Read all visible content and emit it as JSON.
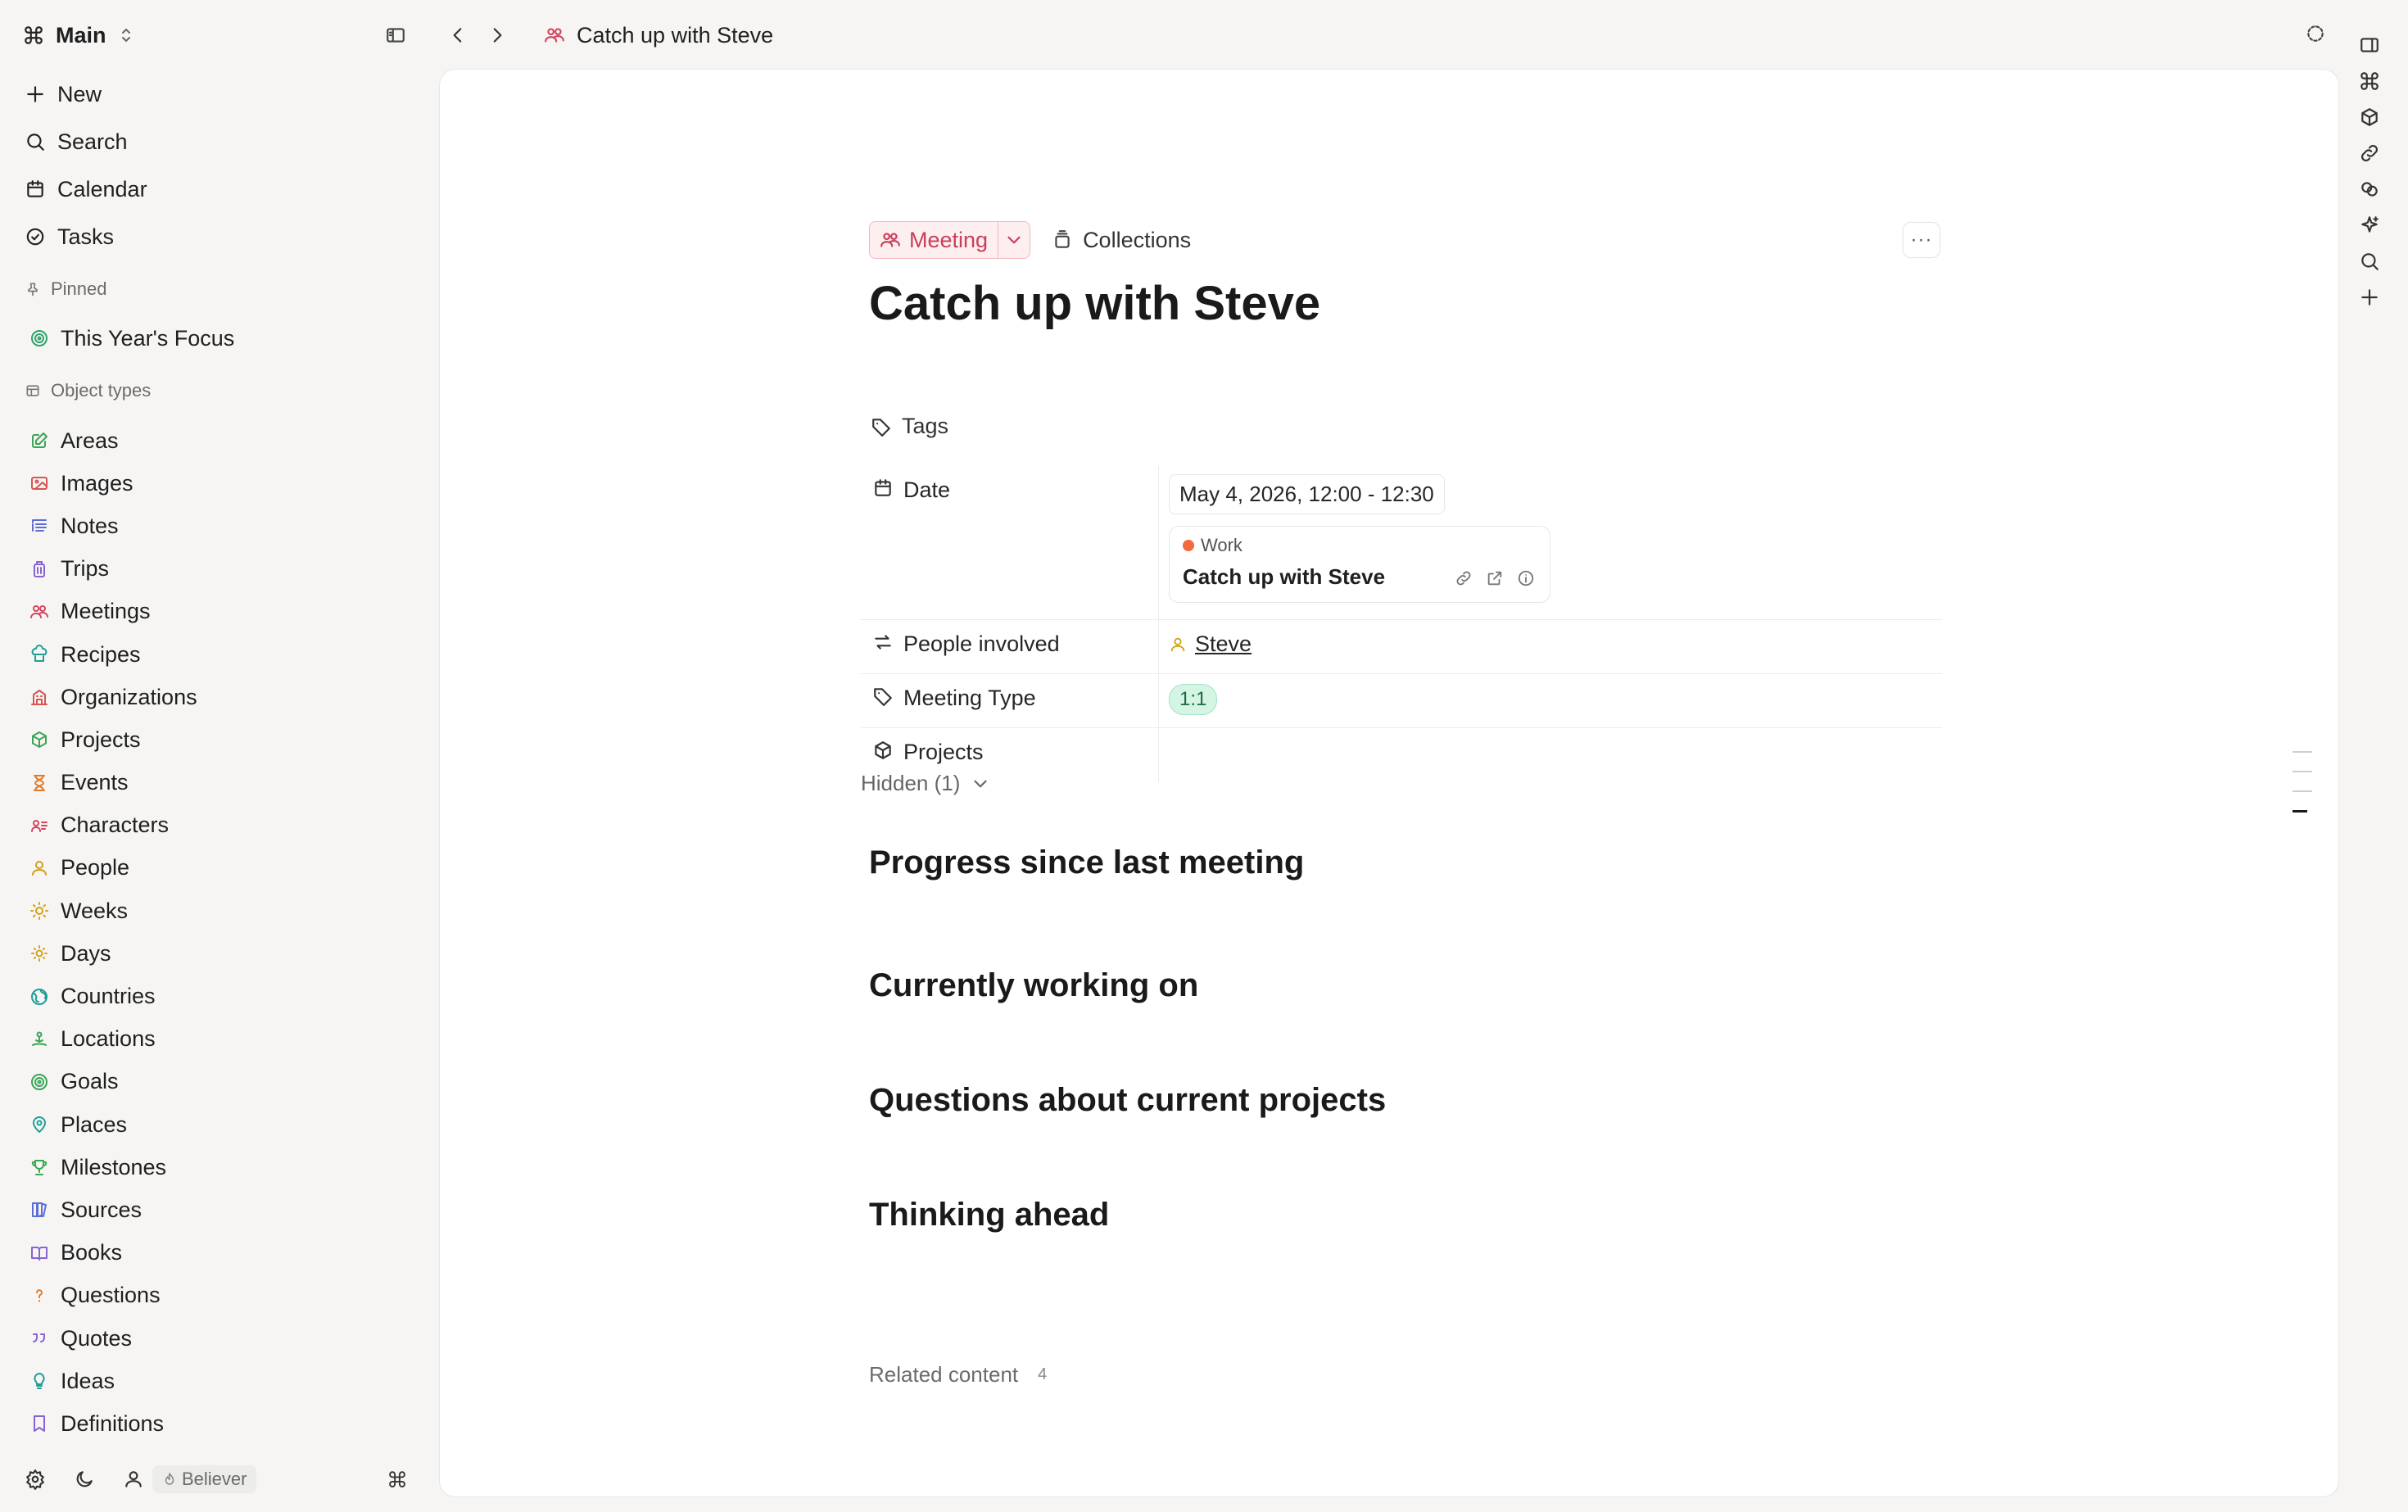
{
  "workspace": {
    "name": "Main"
  },
  "breadcrumb": {
    "title": "Catch up with Steve"
  },
  "nav": [
    {
      "label": "New",
      "icon": "plus-icon"
    },
    {
      "label": "Search",
      "icon": "search-icon"
    },
    {
      "label": "Calendar",
      "icon": "calendar-icon"
    },
    {
      "label": "Tasks",
      "icon": "check-circle-icon"
    }
  ],
  "pinned": {
    "label": "Pinned",
    "items": [
      {
        "label": "This Year's Focus",
        "icon": "target-icon",
        "color": "#2fa36b"
      }
    ]
  },
  "object_types": {
    "label": "Object types",
    "items": [
      {
        "label": "Areas",
        "icon": "pencil-square-icon",
        "color": "#3aa655"
      },
      {
        "label": "Images",
        "icon": "image-icon",
        "color": "#d9534f"
      },
      {
        "label": "Notes",
        "icon": "notes-icon",
        "color": "#5b6fd6"
      },
      {
        "label": "Trips",
        "icon": "luggage-icon",
        "color": "#8a63d2"
      },
      {
        "label": "Meetings",
        "icon": "people-icon",
        "color": "#d6455f"
      },
      {
        "label": "Recipes",
        "icon": "chef-hat-icon",
        "color": "#1f9e97"
      },
      {
        "label": "Organizations",
        "icon": "building-icon",
        "color": "#d9534f"
      },
      {
        "label": "Projects",
        "icon": "cube-icon",
        "color": "#3aa655"
      },
      {
        "label": "Events",
        "icon": "hourglass-icon",
        "color": "#e07b2b"
      },
      {
        "label": "Characters",
        "icon": "person-card-icon",
        "color": "#d6455f"
      },
      {
        "label": "People",
        "icon": "person-icon",
        "color": "#d4a017"
      },
      {
        "label": "Weeks",
        "icon": "sun-icon",
        "color": "#d4a017"
      },
      {
        "label": "Days",
        "icon": "sun-small-icon",
        "color": "#d4a017"
      },
      {
        "label": "Countries",
        "icon": "globe-icon",
        "color": "#1f9e97"
      },
      {
        "label": "Locations",
        "icon": "location-person-icon",
        "color": "#3aa655"
      },
      {
        "label": "Goals",
        "icon": "target-icon",
        "color": "#3aa655"
      },
      {
        "label": "Places",
        "icon": "map-pin-icon",
        "color": "#1f9e97"
      },
      {
        "label": "Milestones",
        "icon": "trophy-icon",
        "color": "#3aa655"
      },
      {
        "label": "Sources",
        "icon": "books-icon",
        "color": "#5b6fd6"
      },
      {
        "label": "Books",
        "icon": "open-book-icon",
        "color": "#8a63d2"
      },
      {
        "label": "Questions",
        "icon": "question-icon",
        "color": "#e07b2b"
      },
      {
        "label": "Quotes",
        "icon": "quote-icon",
        "color": "#8a63d2"
      },
      {
        "label": "Ideas",
        "icon": "lightbulb-icon",
        "color": "#1f9e97"
      },
      {
        "label": "Definitions",
        "icon": "bookmark-icon",
        "color": "#8a63d2"
      }
    ]
  },
  "footer": {
    "badge": "Believer",
    "shortcut": "⌘"
  },
  "page": {
    "type_label": "Meeting",
    "collections_label": "Collections",
    "more_label": "···",
    "title": "Catch up with Steve",
    "tags_label": "Tags",
    "properties": {
      "date": {
        "label": "Date",
        "value": "May 4, 2026, 12:00 - 12:30"
      },
      "event": {
        "calendar": "Work",
        "title": "Catch up with Steve"
      },
      "people": {
        "label": "People involved",
        "value": "Steve"
      },
      "meeting_type": {
        "label": "Meeting Type",
        "value": "1:1"
      },
      "projects": {
        "label": "Projects"
      }
    },
    "hidden_label": "Hidden (1)",
    "sections": [
      "Progress since last meeting",
      "Currently working on",
      "Questions about current projects",
      "Thinking ahead"
    ],
    "related": {
      "label": "Related content",
      "count": "4"
    }
  },
  "colors": {
    "accent_meeting": "#c93e58",
    "pill_green": "#d4f4e4",
    "calendar_dot": "#f06a3a"
  }
}
